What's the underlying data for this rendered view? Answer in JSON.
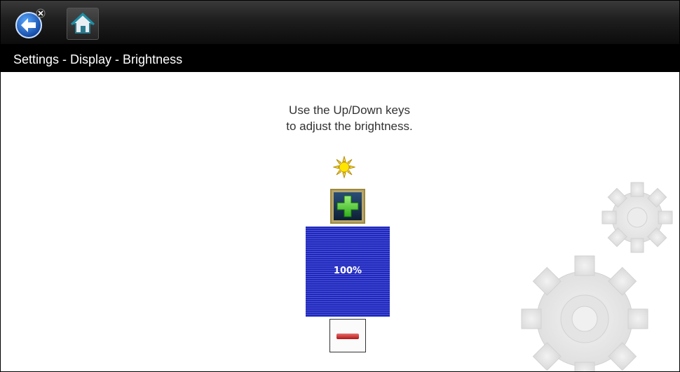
{
  "toolbar": {
    "back_icon": "back-arrow-icon",
    "home_icon": "home-icon"
  },
  "breadcrumb": "Settings - Display - Brightness",
  "instructions": {
    "line1": "Use the Up/Down keys",
    "line2": "to adjust the brightness."
  },
  "brightness": {
    "level": 1.0,
    "label": "100%",
    "icon": "sun-icon"
  },
  "colors": {
    "bar_blue": "#2e36c6",
    "plus_green": "#5cd63a",
    "minus_red": "#d02a2a"
  }
}
